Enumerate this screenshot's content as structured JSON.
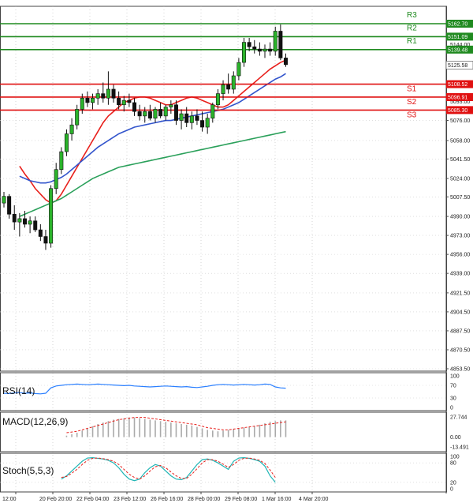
{
  "chart_data": {
    "type": "candlestick",
    "price_axis": {
      "ticks": [
        "5076.00",
        "5058.00",
        "5041.50",
        "5024.00",
        "5007.50",
        "4990.00",
        "4973.00",
        "4956.00",
        "4939.00",
        "4921.50",
        "4904.50",
        "4887.50",
        "4870.50",
        "4853.50"
      ],
      "range": [
        4853.5,
        5162.7
      ]
    },
    "time_axis": {
      "labels": [
        "12:00",
        "20 Feb 20:00",
        "22 Feb 04:00",
        "23 Feb 12:00",
        "26 Feb 16:00",
        "28 Feb 00:00",
        "29 Feb 08:00",
        "1 Mar 16:00",
        "4 Mar 20:00"
      ]
    },
    "levels": [
      {
        "name": "R3",
        "value": 5162.7,
        "value_label": "5162.70",
        "color": "#1f8a1f"
      },
      {
        "name": "R2",
        "value": 5151.09,
        "value_label": "5151.09",
        "color": "#1f8a1f"
      },
      {
        "name": "R1",
        "value": 5139.48,
        "value_label": "5139.48",
        "color": "#1f8a1f"
      },
      {
        "name": "S1",
        "value": 5108.52,
        "value_label": "5108.52",
        "color": "#e01010"
      },
      {
        "name": "S2",
        "value": 5096.91,
        "value_label": "5096.91",
        "color": "#e01010"
      },
      {
        "name": "S3",
        "value": 5085.3,
        "value_label": "5085.30",
        "color": "#e01010"
      }
    ],
    "axis_extra_ticks": [
      {
        "value": 5144.0,
        "label": "5144.00"
      },
      {
        "value": 5093.0,
        "label": "5093.00"
      }
    ],
    "current_price": {
      "value": 5125.58,
      "label": "5125.58"
    },
    "candles": [
      [
        5002,
        5012,
        4998,
        5008
      ],
      [
        5008,
        5010,
        4988,
        4992
      ],
      [
        4992,
        5000,
        4978,
        4985
      ],
      [
        4985,
        4993,
        4972,
        4988
      ],
      [
        4988,
        4995,
        4980,
        4983
      ],
      [
        4983,
        4990,
        4975,
        4986
      ],
      [
        4986,
        4990,
        4976,
        4978
      ],
      [
        4978,
        4983,
        4968,
        4972
      ],
      [
        4972,
        4978,
        4960,
        4966
      ],
      [
        4966,
        5018,
        4962,
        5015
      ],
      [
        5015,
        5038,
        5010,
        5032
      ],
      [
        5032,
        5052,
        5028,
        5048
      ],
      [
        5048,
        5068,
        5044,
        5064
      ],
      [
        5064,
        5078,
        5058,
        5072
      ],
      [
        5072,
        5090,
        5068,
        5086
      ],
      [
        5086,
        5100,
        5082,
        5096
      ],
      [
        5096,
        5102,
        5088,
        5092
      ],
      [
        5092,
        5100,
        5086,
        5096
      ],
      [
        5096,
        5104,
        5090,
        5100
      ],
      [
        5100,
        5110,
        5092,
        5096
      ],
      [
        5096,
        5120,
        5090,
        5104
      ],
      [
        5104,
        5108,
        5092,
        5096
      ],
      [
        5096,
        5102,
        5086,
        5090
      ],
      [
        5090,
        5098,
        5084,
        5094
      ],
      [
        5094,
        5100,
        5088,
        5092
      ],
      [
        5092,
        5096,
        5080,
        5084
      ],
      [
        5084,
        5090,
        5076,
        5080
      ],
      [
        5080,
        5088,
        5074,
        5084
      ],
      [
        5084,
        5090,
        5076,
        5078
      ],
      [
        5078,
        5088,
        5074,
        5086
      ],
      [
        5086,
        5092,
        5078,
        5080
      ],
      [
        5080,
        5090,
        5076,
        5088
      ],
      [
        5088,
        5094,
        5082,
        5090
      ],
      [
        5090,
        5094,
        5072,
        5076
      ],
      [
        5076,
        5086,
        5068,
        5082
      ],
      [
        5082,
        5088,
        5070,
        5074
      ],
      [
        5074,
        5084,
        5068,
        5080
      ],
      [
        5080,
        5086,
        5072,
        5076
      ],
      [
        5076,
        5084,
        5066,
        5070
      ],
      [
        5070,
        5082,
        5064,
        5078
      ],
      [
        5078,
        5092,
        5074,
        5090
      ],
      [
        5090,
        5104,
        5086,
        5100
      ],
      [
        5100,
        5112,
        5094,
        5108
      ],
      [
        5108,
        5118,
        5100,
        5104
      ],
      [
        5104,
        5120,
        5100,
        5116
      ],
      [
        5116,
        5132,
        5112,
        5128
      ],
      [
        5128,
        5150,
        5124,
        5146
      ],
      [
        5146,
        5150,
        5138,
        5142
      ],
      [
        5142,
        5148,
        5136,
        5140
      ],
      [
        5140,
        5146,
        5134,
        5138
      ],
      [
        5138,
        5144,
        5132,
        5140
      ],
      [
        5140,
        5146,
        5134,
        5138
      ],
      [
        5138,
        5160,
        5134,
        5156
      ],
      [
        5156,
        5162,
        5130,
        5132
      ],
      [
        5132,
        5136,
        5124,
        5126
      ]
    ],
    "moving_averages": [
      {
        "color": "#e8201c",
        "values": [
          5035,
          5028,
          5022,
          5015,
          5010,
          5005,
          5002,
          5004,
          5010,
          5018,
          5026,
          5034,
          5042,
          5050,
          5058,
          5066,
          5074,
          5080,
          5084,
          5088,
          5092,
          5094,
          5096,
          5097,
          5097,
          5096,
          5094,
          5092,
          5090,
          5090,
          5092,
          5094,
          5096,
          5097,
          5096,
          5094,
          5092,
          5090,
          5088,
          5088,
          5090,
          5094,
          5098,
          5102,
          5106,
          5110,
          5114,
          5118,
          5122,
          5125,
          5128,
          5130
        ]
      },
      {
        "color": "#3355cc",
        "values": [
          5026,
          5024,
          5022,
          5021,
          5020,
          5020,
          5021,
          5023,
          5025,
          5028,
          5032,
          5036,
          5040,
          5044,
          5048,
          5052,
          5055,
          5058,
          5061,
          5064,
          5066,
          5068,
          5070,
          5071,
          5072,
          5073,
          5074,
          5075,
          5076,
          5076,
          5077,
          5078,
          5079,
          5080,
          5081,
          5082,
          5083,
          5084,
          5085,
          5086,
          5088,
          5090,
          5092,
          5095,
          5098,
          5101,
          5104,
          5107,
          5110,
          5113,
          5115,
          5118
        ]
      },
      {
        "color": "#2aa05a",
        "values": [
          4990,
          4992,
          4994,
          4996,
          4998,
          5000,
          5002,
          5004,
          5006,
          5009,
          5012,
          5015,
          5018,
          5021,
          5024,
          5026,
          5028,
          5030,
          5032,
          5034,
          5035,
          5036,
          5037,
          5038,
          5039,
          5040,
          5041,
          5042,
          5043,
          5044,
          5045,
          5046,
          5047,
          5048,
          5049,
          5050,
          5051,
          5052,
          5053,
          5054,
          5055,
          5056,
          5057,
          5058,
          5059,
          5060,
          5061,
          5062,
          5063,
          5064,
          5065,
          5066
        ]
      }
    ],
    "indicators": {
      "rsi": {
        "label": "RSI(14)",
        "ticks": [
          "100",
          "70",
          "30",
          "0"
        ],
        "values": [
          45,
          44,
          46,
          47,
          45,
          46,
          44,
          43,
          45,
          62,
          68,
          70,
          72,
          73,
          74,
          73,
          72,
          73,
          74,
          73,
          72,
          71,
          70,
          69,
          70,
          68,
          67,
          66,
          65,
          66,
          67,
          68,
          67,
          66,
          65,
          66,
          64,
          63,
          65,
          67,
          70,
          72,
          73,
          72,
          71,
          72,
          73,
          72,
          71,
          72,
          74,
          73,
          65,
          62,
          61
        ]
      },
      "macd": {
        "label": "MACD(12,26,9)",
        "ticks": [
          "27.744",
          "0.00",
          "-13.491"
        ],
        "histogram": [
          2,
          4,
          6,
          9,
          12,
          15,
          18,
          20,
          22,
          24,
          25,
          26,
          27,
          27,
          26,
          25,
          24,
          23,
          22,
          21,
          20,
          19,
          18,
          17,
          16,
          14,
          12,
          10,
          9,
          8,
          9,
          10,
          11,
          12,
          13,
          14,
          15,
          17,
          19,
          21,
          22,
          23,
          23
        ],
        "signal": [
          6,
          7,
          8,
          10,
          12,
          14,
          16,
          18,
          20,
          22,
          24,
          25,
          26,
          27,
          27,
          27,
          26,
          25,
          24,
          23,
          22,
          21,
          20,
          19,
          18,
          17,
          15,
          13,
          12,
          11,
          10,
          10,
          11,
          12,
          13,
          14,
          15,
          16,
          17,
          18,
          19,
          20,
          21
        ]
      },
      "stoch": {
        "label": "Stoch(5,5,3)",
        "ticks": [
          "100",
          "80",
          "20",
          "0"
        ],
        "main": [
          30,
          40,
          55,
          70,
          85,
          95,
          96,
          94,
          92,
          88,
          80,
          65,
          45,
          30,
          25,
          30,
          50,
          65,
          75,
          70,
          55,
          40,
          30,
          28,
          35,
          55,
          75,
          90,
          92,
          88,
          80,
          70,
          60,
          85,
          95,
          96,
          94,
          90,
          85,
          70,
          40,
          20
        ],
        "signal": [
          35,
          38,
          48,
          60,
          75,
          88,
          94,
          95,
          93,
          90,
          85,
          75,
          60,
          45,
          35,
          30,
          40,
          55,
          68,
          72,
          65,
          52,
          40,
          32,
          32,
          45,
          62,
          80,
          90,
          90,
          85,
          76,
          66,
          75,
          88,
          94,
          95,
          92,
          88,
          78,
          58,
          35
        ]
      }
    }
  }
}
